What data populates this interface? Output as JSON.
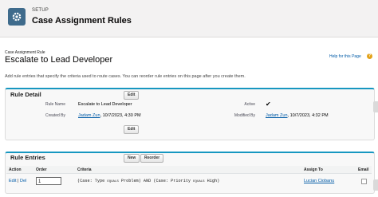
{
  "header": {
    "crumb": "SETUP",
    "title": "Case Assignment Rules",
    "icon": "gear-icon",
    "icon_color": "#3f6b8c"
  },
  "record": {
    "subtitle": "Case Assignment Rule",
    "title": "Escalate to Lead Developer",
    "help_link": "Help for this Page",
    "description": "Add rule entries that specify the criteria used to route cases. You can reorder rule entries on this page after you create them."
  },
  "rule_detail": {
    "heading": "Rule Detail",
    "edit_label": "Edit",
    "fields": {
      "rule_name_label": "Rule Name",
      "rule_name": "Escalate to Lead Developer",
      "active_label": "Active",
      "active_mark": "✔",
      "created_by_label": "Created By",
      "created_by_user": "Jadam Zun",
      "created_by_date": ", 10/7/2023, 4:30 PM",
      "modified_by_label": "Modified By",
      "modified_by_user": "Jadam Zun",
      "modified_by_date": ", 10/7/2023, 4:32 PM"
    },
    "accent_color": "#1797c0"
  },
  "rule_entries": {
    "heading": "Rule Entries",
    "new_label": "New",
    "reorder_label": "Reorder",
    "columns": [
      "Action",
      "Order",
      "Criteria",
      "Assign To",
      "Email"
    ],
    "rows": [
      {
        "edit": "Edit",
        "sep": " | ",
        "del": "Del",
        "order": "1",
        "criteria_a": "(Case: Type ",
        "criteria_op1": "EQUALS",
        "criteria_b": " Problem) AND (Case: Priority ",
        "criteria_op2": "EQUALS",
        "criteria_c": " High)",
        "assign_to": "Lucian Ciobanu"
      }
    ]
  }
}
